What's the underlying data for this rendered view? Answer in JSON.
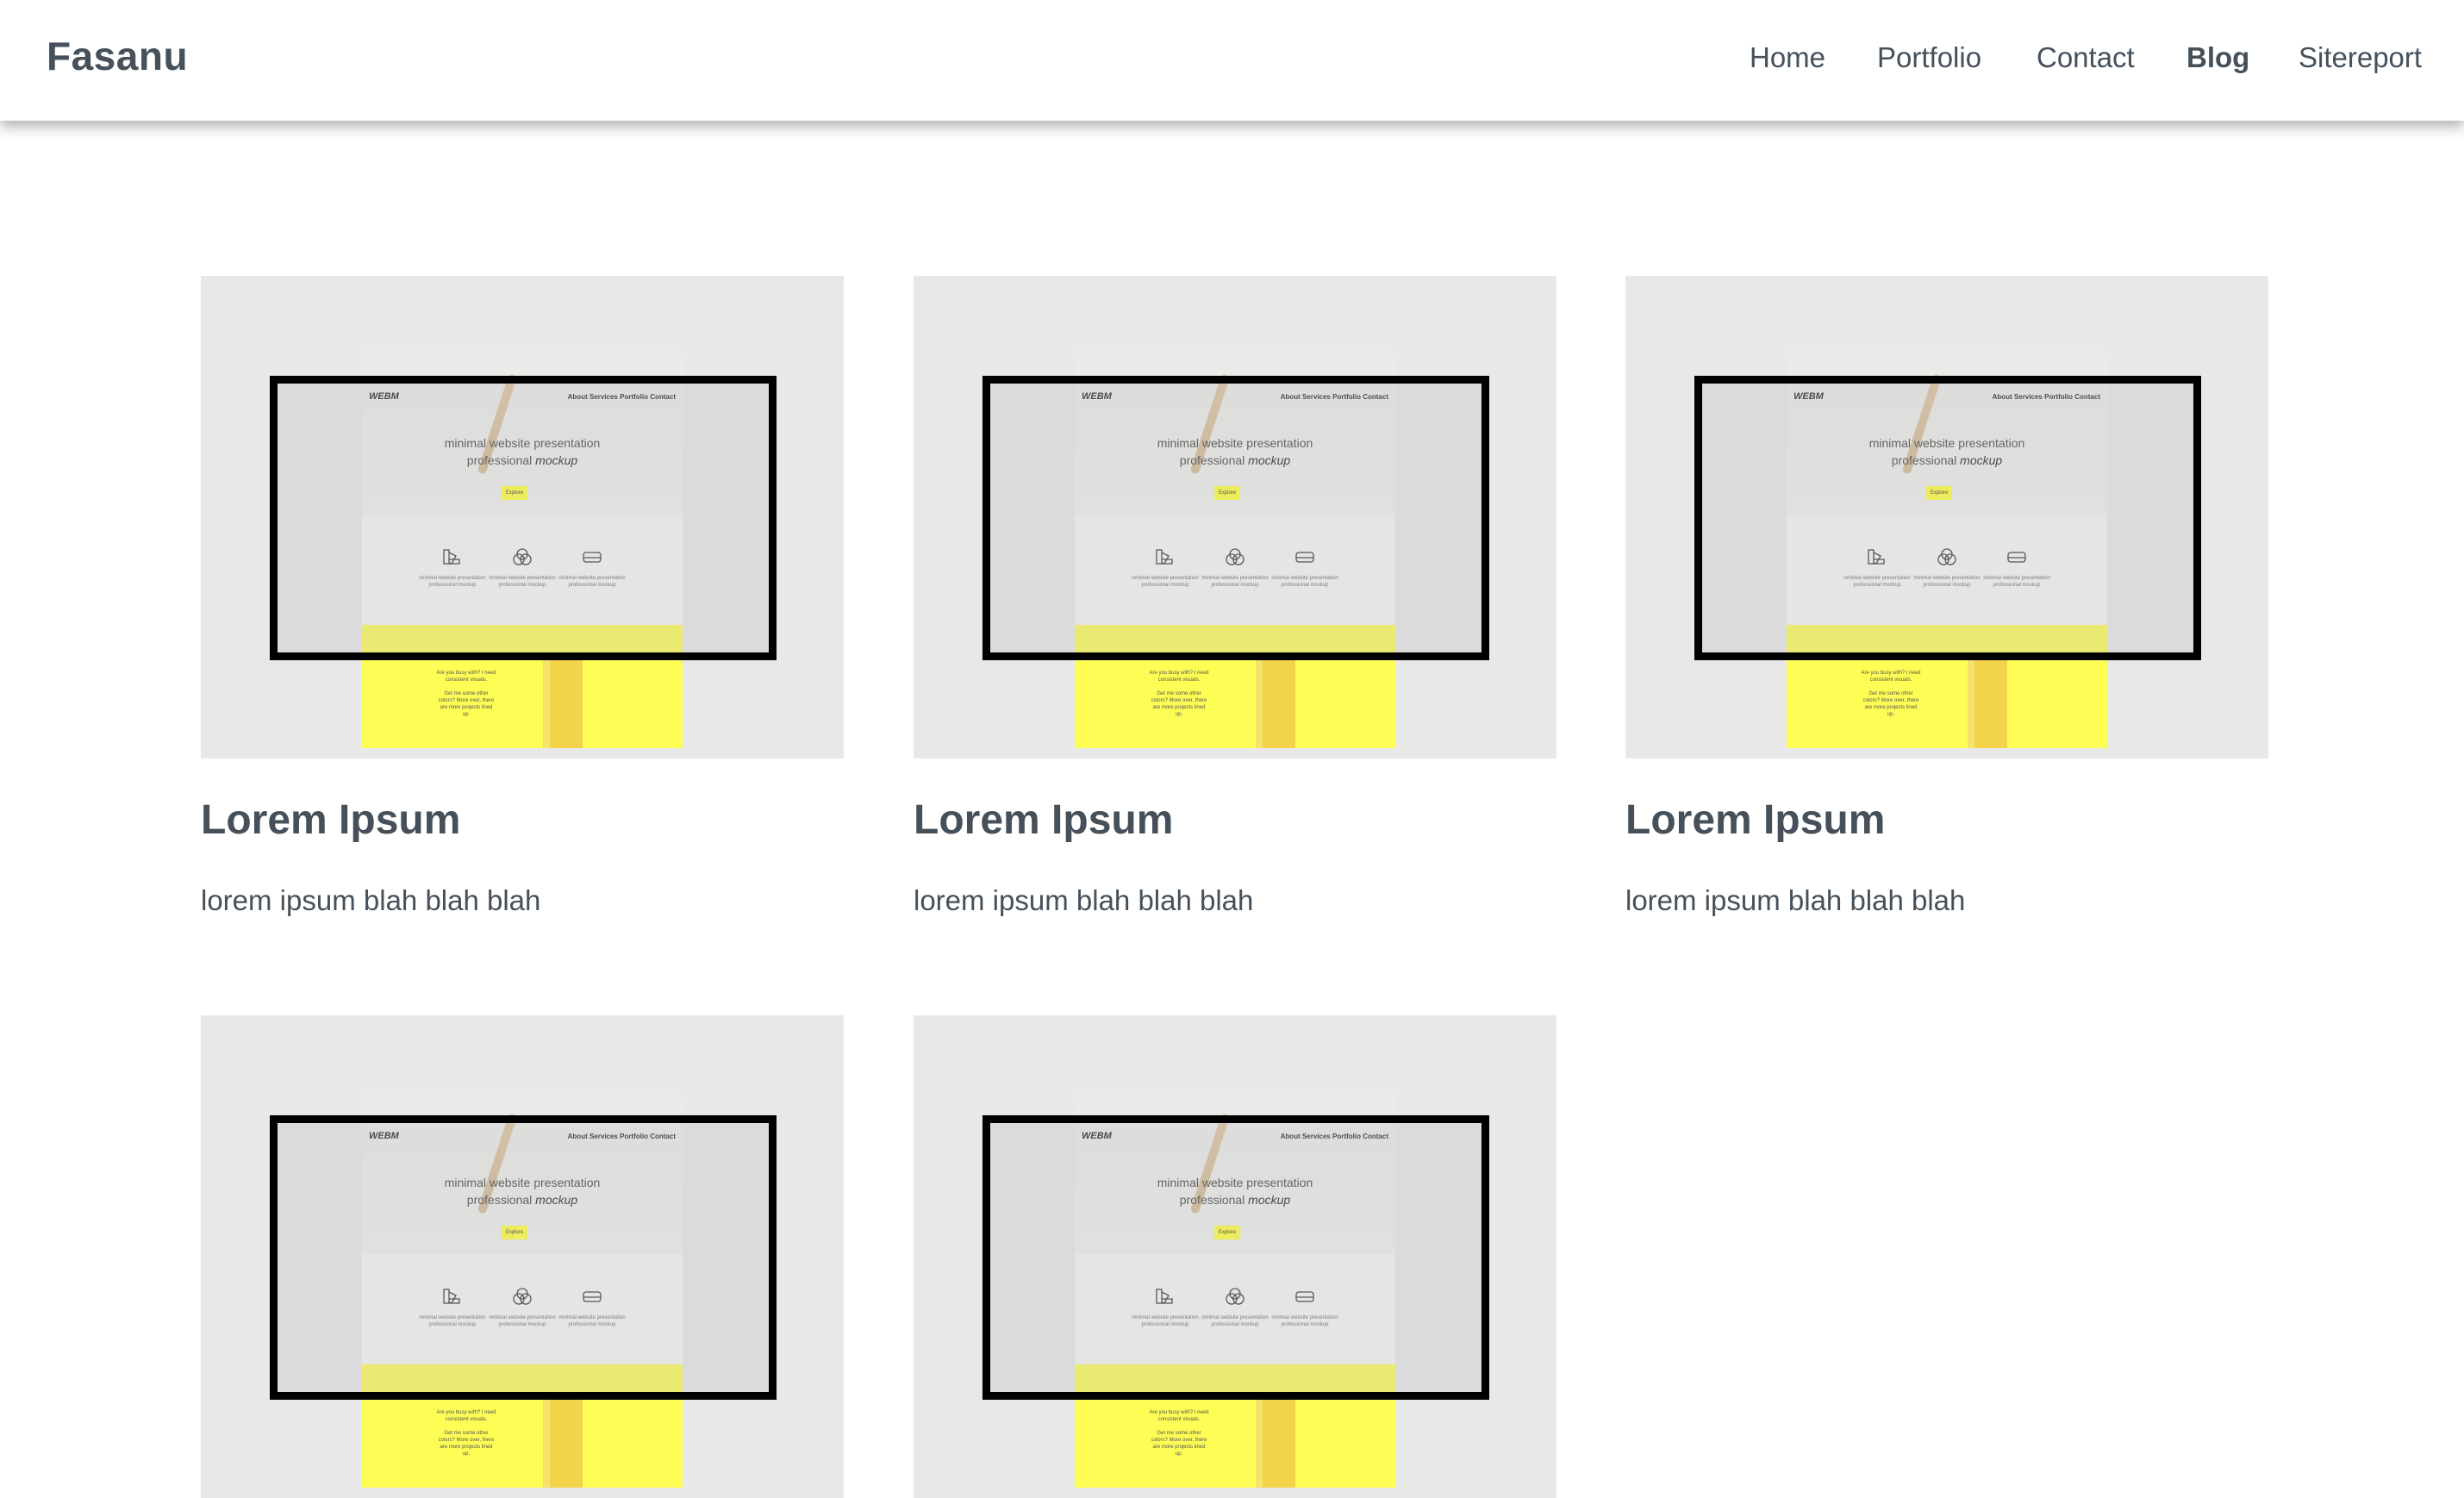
{
  "header": {
    "brand": "Fasanu",
    "nav": [
      {
        "label": "Home",
        "active": false
      },
      {
        "label": "Portfolio",
        "active": false
      },
      {
        "label": "Contact",
        "active": false
      },
      {
        "label": "Blog",
        "active": true
      },
      {
        "label": "Sitereport",
        "active": false
      }
    ]
  },
  "mockup": {
    "logo": "WEBM",
    "nav": "About Services Portfolio Contact",
    "headline_1": "minimal website presentation",
    "headline_2_plain": "professional ",
    "headline_2_italic": "mockup",
    "button": "Explore"
  },
  "posts": [
    {
      "title": "Lorem Ipsum",
      "excerpt": "lorem ipsum blah blah blah"
    },
    {
      "title": "Lorem Ipsum",
      "excerpt": "lorem ipsum blah blah blah"
    },
    {
      "title": "Lorem Ipsum",
      "excerpt": "lorem ipsum blah blah blah"
    },
    {
      "title": "",
      "excerpt": ""
    },
    {
      "title": "",
      "excerpt": ""
    }
  ],
  "colors": {
    "text": "#45505a",
    "thumb_bg": "#e8e8e8",
    "mock_yellow": "#fdfd56",
    "monitor_frame": "#000000"
  }
}
